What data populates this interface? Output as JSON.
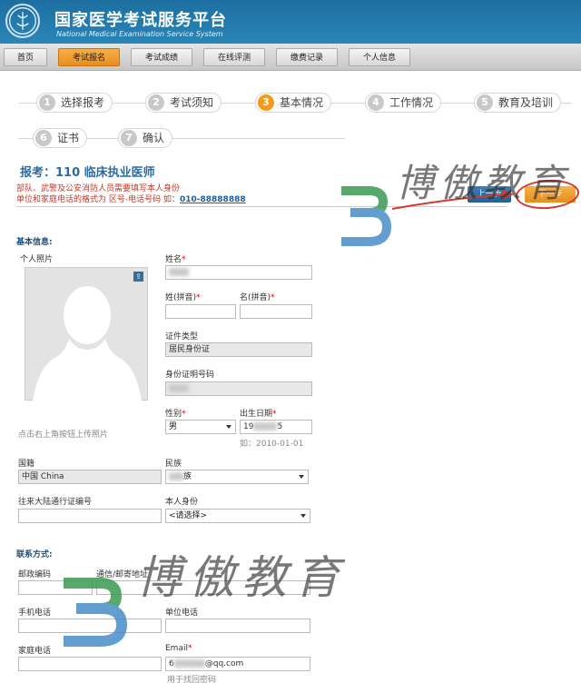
{
  "header": {
    "title_cn": "国家医学考试服务平台",
    "title_en": "National Medical Examination Service System"
  },
  "nav": {
    "items": [
      {
        "label": "首页"
      },
      {
        "label": "考试报名"
      },
      {
        "label": "考试成绩"
      },
      {
        "label": "在线评测"
      },
      {
        "label": "缴费记录"
      },
      {
        "label": "个人信息"
      }
    ],
    "active_index": 1
  },
  "steps": [
    {
      "num": "1",
      "label": "选择报考"
    },
    {
      "num": "2",
      "label": "考试须知"
    },
    {
      "num": "3",
      "label": "基本情况"
    },
    {
      "num": "4",
      "label": "工作情况"
    },
    {
      "num": "5",
      "label": "教育及培训"
    },
    {
      "num": "6",
      "label": "证书"
    },
    {
      "num": "7",
      "label": "确认"
    }
  ],
  "active_step": "3",
  "exam": {
    "title": "报考：110 临床执业医师",
    "notice1": "部队、武警及公安消防人员需要填写本人身份",
    "notice2_prefix": "单位和家庭电话的格式为 区号-电话号码 如：",
    "notice2_example": "010-88888888"
  },
  "buttons": {
    "prev": "上一步",
    "next": "下一步"
  },
  "basic": {
    "section": "基本信息:",
    "photo_label": "个人照片",
    "photo_upload_icon": "⇪",
    "photo_hint": "点击右上角按钮上传照片",
    "name_label": "姓名",
    "surname_pinyin_label": "姓(拼音)",
    "givenname_pinyin_label": "名(拼音)",
    "id_type_label": "证件类型",
    "id_type_value": "居民身份证",
    "id_number_label": "身份证明号码",
    "gender_label": "性别",
    "gender_value": "男",
    "birth_label": "出生日期",
    "birth_value_start": "19",
    "birth_value_end": "5",
    "birth_hint": "如：2010-01-01",
    "nationality_label": "国籍",
    "nationality_value": "中国 China",
    "ethnicity_label": "民族",
    "ethnicity_value": "族",
    "hkmo_label": "往来大陆通行证编号",
    "identity_label": "本人身份",
    "identity_value": "<请选择>"
  },
  "contact": {
    "section": "联系方式:",
    "postcode_label": "邮政编码",
    "address_label": "通信/邮寄地址",
    "mobile_label": "手机电话",
    "work_phone_label": "单位电话",
    "home_phone_label": "家庭电话",
    "email_label": "Email",
    "email_value_start": "6",
    "email_value_end": "@qq.com",
    "email_hint": "用于找回密码"
  },
  "watermark": {
    "text": "博傲教育"
  },
  "colors": {
    "header_blue": "#1d6ea0",
    "accent_orange": "#f39a1a",
    "required_red": "#dd0000",
    "title_blue": "#2a6ca3"
  }
}
